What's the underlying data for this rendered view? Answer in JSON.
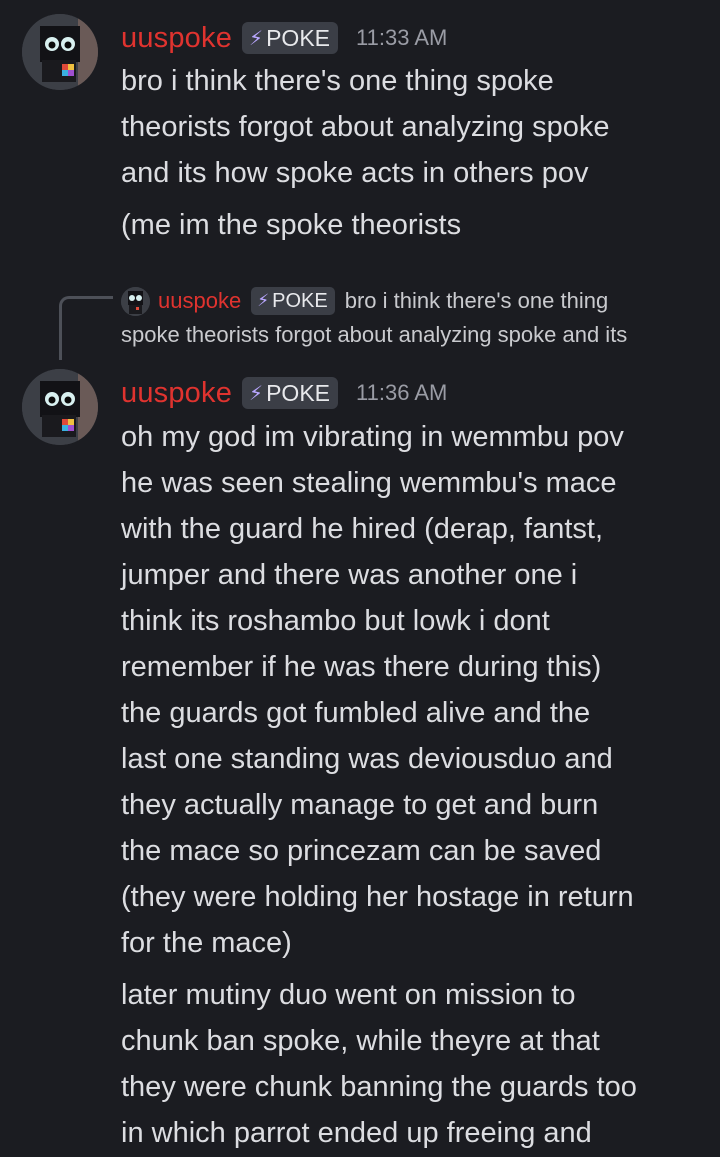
{
  "messages": [
    {
      "username": "uuspoke",
      "tag": "POKE",
      "time": "11:33 AM",
      "paragraphs": [
        [
          "bro i think there's one thing spoke",
          "theorists forgot about analyzing spoke",
          "and its how spoke acts in others pov"
        ],
        [
          "(me im the spoke theorists"
        ]
      ]
    },
    {
      "reply": {
        "username": "uuspoke",
        "tag": "POKE",
        "snippet_line1": "bro i think there's one thing",
        "snippet_line2": "spoke theorists forgot about analyzing spoke and its"
      },
      "username": "uuspoke",
      "tag": "POKE",
      "time": "11:36 AM",
      "paragraphs": [
        [
          "oh my god im vibrating in wemmbu pov",
          "he was seen stealing wemmbu's mace",
          "with the guard he hired (derap, fantst,",
          "jumper and there was another one i",
          "think its roshambo but lowk i dont",
          "remember if he was there during this)",
          "the guards got fumbled alive and the",
          "last one standing was deviousduo and",
          "they actually manage to get and burn",
          "the mace so princezam can be saved",
          "(they were holding her hostage in return",
          "for the mace)"
        ],
        [
          "later mutiny duo went on mission to",
          "chunk ban spoke, while theyre at that",
          "they were chunk banning the guards too",
          "in which parrot ended up freeing and"
        ]
      ]
    }
  ]
}
